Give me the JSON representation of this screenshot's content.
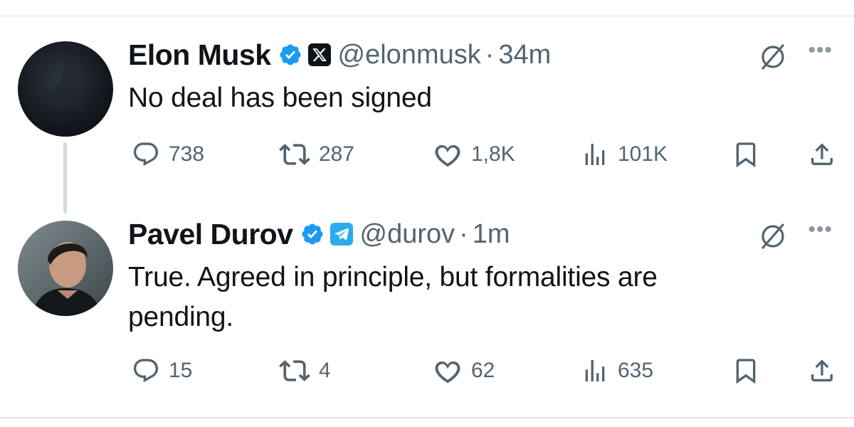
{
  "tweets": [
    {
      "name": "Elon Musk",
      "handle": "@elonmusk",
      "separator": "·",
      "time": "34m",
      "text": "No deal has been signed",
      "affiliation": "x-logo-icon",
      "stats": {
        "replies": "738",
        "reposts": "287",
        "likes": "1,8K",
        "views": "101K"
      }
    },
    {
      "name": "Pavel Durov",
      "handle": "@durov",
      "separator": "·",
      "time": "1m",
      "text": "True. Agreed in principle, but formalities are pending.",
      "affiliation": "telegram-logo-icon",
      "stats": {
        "replies": "15",
        "reposts": "4",
        "likes": "62",
        "views": "635"
      }
    }
  ],
  "colors": {
    "verified": "#1d9bf0",
    "muted": "#536471",
    "text": "#0f1419",
    "telegram": "#2aabee",
    "thread_line": "#cfd9de"
  },
  "icons": {
    "more": "•••",
    "grok": "grok-icon",
    "reply": "reply-icon",
    "repost": "repost-icon",
    "like": "heart-icon",
    "views": "views-icon",
    "bookmark": "bookmark-icon",
    "share": "share-icon"
  }
}
